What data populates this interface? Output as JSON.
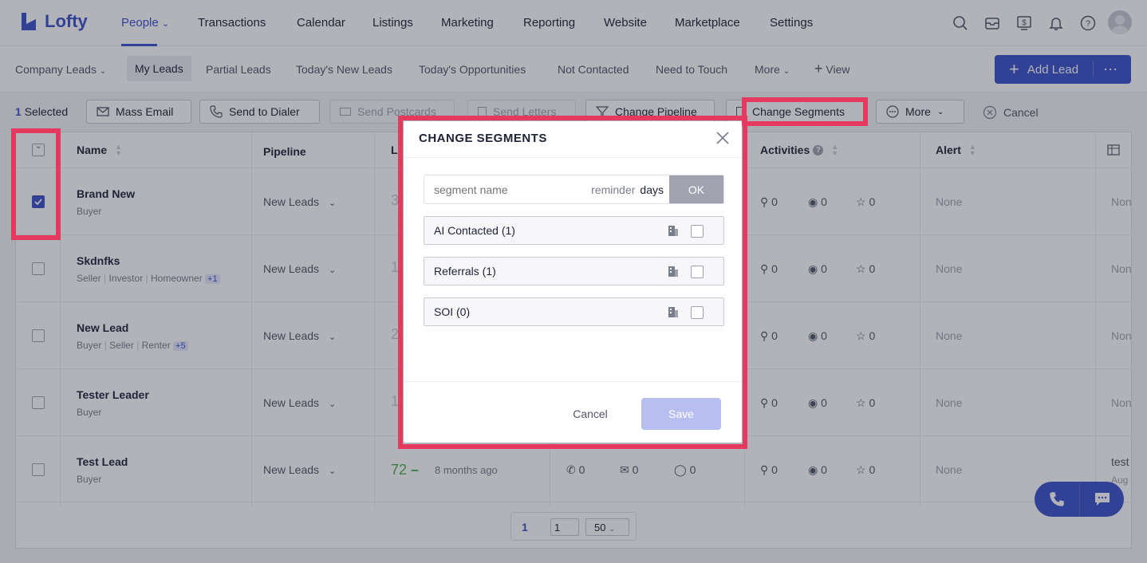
{
  "app": {
    "name": "Lofty",
    "brand_color": "#3b50c9"
  },
  "topnav": {
    "items": [
      "People",
      "Transactions",
      "Calendar",
      "Listings",
      "Marketing",
      "Reporting",
      "Website",
      "Marketplace",
      "Settings"
    ],
    "active": "People",
    "icons": [
      "search-icon",
      "inbox-icon",
      "billing-icon",
      "bell-icon",
      "help-icon",
      "avatar"
    ]
  },
  "subnav": {
    "items": [
      "Company Leads",
      "My Leads",
      "Partial Leads",
      "Today's New Leads",
      "Today's Opportunities",
      "Not Contacted",
      "Need to Touch",
      "More",
      "View"
    ],
    "active": "My Leads",
    "add_lead": "Add Lead"
  },
  "actionbar": {
    "selected_count": "1",
    "selected_label": "Selected",
    "mass_email": "Mass Email",
    "send_to_dialer": "Send to Dialer",
    "send_postcards": "Send Postcards",
    "send_letters": "Send Letters",
    "change_pipeline": "Change Pipeline",
    "change_segments": "Change Segments",
    "more": "More",
    "cancel": "Cancel"
  },
  "table": {
    "headers": {
      "name": "Name",
      "pipeline": "Pipeline",
      "lead_score": "L",
      "activities": "Activities",
      "alert": "Alert"
    },
    "rows": [
      {
        "name": "Brand New",
        "tags": [
          "Buyer"
        ],
        "extra": "",
        "pipeline": "New Leads",
        "score": "3",
        "checked": true,
        "alert": "None",
        "q": "0",
        "v": "0",
        "s": "0",
        "tail": "Non"
      },
      {
        "name": "Skdnfks",
        "tags": [
          "Seller",
          "Investor",
          "Homeowner"
        ],
        "extra": "+1",
        "pipeline": "New Leads",
        "score": "1",
        "checked": false,
        "alert": "None",
        "q": "0",
        "v": "0",
        "s": "0",
        "tail": "Non"
      },
      {
        "name": "New Lead",
        "tags": [
          "Buyer",
          "Seller",
          "Renter"
        ],
        "extra": "+5",
        "pipeline": "New Leads",
        "score": "2",
        "checked": false,
        "alert": "None",
        "q": "0",
        "v": "0",
        "s": "0",
        "tail": "Non"
      },
      {
        "name": "Tester Leader",
        "tags": [
          "Buyer"
        ],
        "extra": "",
        "pipeline": "New Leads",
        "score": "1",
        "checked": false,
        "alert": "None",
        "q": "0",
        "v": "0",
        "s": "0",
        "tail": "Non"
      },
      {
        "name": "Test Lead",
        "tags": [
          "Buyer"
        ],
        "extra": "",
        "pipeline": "New Leads",
        "score": "72",
        "checked": false,
        "alert": "None",
        "q": "0",
        "v": "0",
        "s": "0",
        "tail": "test",
        "tail2": "Aug",
        "time": "8 months ago",
        "call": "0",
        "mail": "0",
        "sms": "0"
      }
    ]
  },
  "pager": {
    "current": "1",
    "input": "1",
    "size": "50"
  },
  "modal": {
    "title": "CHANGE SEGMENTS",
    "input_placeholder": "segment name",
    "reminder": "reminder",
    "days": "days",
    "ok": "OK",
    "segments": [
      "AI Contacted (1)",
      "Referrals (1)",
      "SOI (0)"
    ],
    "cancel": "Cancel",
    "save": "Save"
  },
  "highlight_color": "#e6395f"
}
